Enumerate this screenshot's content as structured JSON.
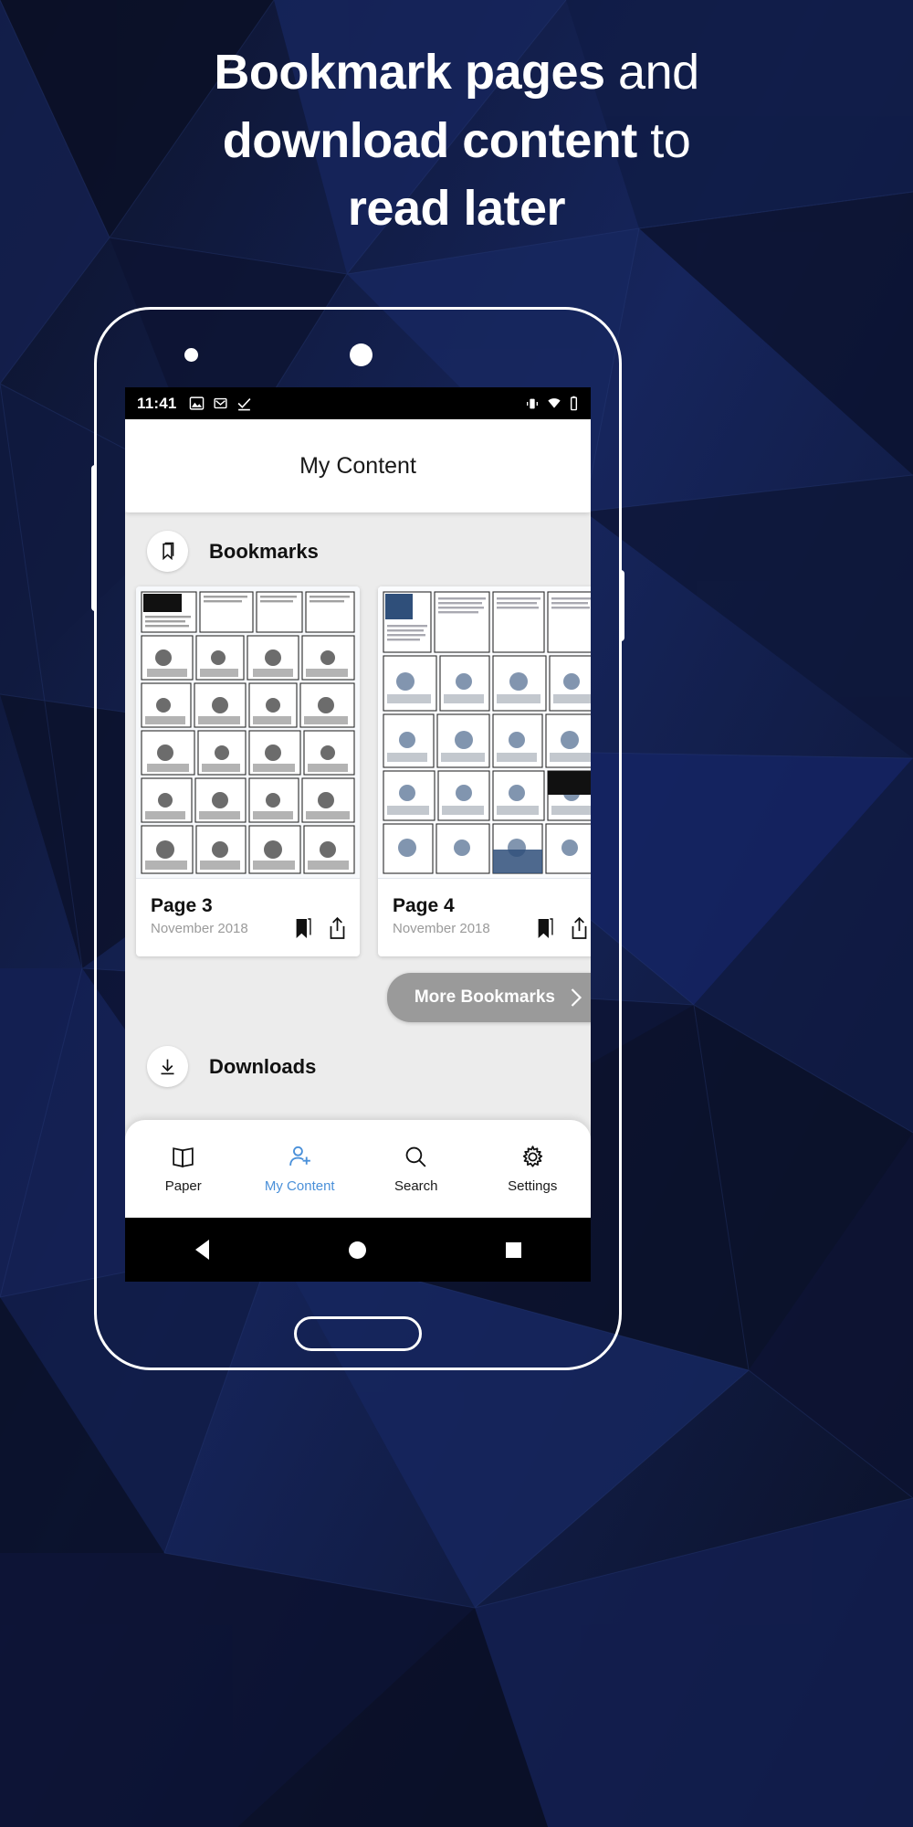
{
  "headline": {
    "line1_bold": "Bookmark pages",
    "line1_rest": " and",
    "line2_bold": "download content",
    "line2_rest": " to",
    "line3": "read later"
  },
  "colors": {
    "background_dark": "#0d1530",
    "background_mid": "#16255c",
    "accent_blue": "#4a90d9",
    "button_gray": "#9a9a9a",
    "app_body": "#ececec",
    "date_text": "#9a9a9a"
  },
  "statusbar": {
    "time": "11:41",
    "left_icons": [
      "photos-icon",
      "gmail-icon",
      "checkmark-icon"
    ],
    "right_icons": [
      "vibrate-icon",
      "wifi-icon",
      "battery-icon"
    ]
  },
  "header": {
    "title": "My Content"
  },
  "sections": [
    {
      "icon": "bookmark-icon",
      "label": "Bookmarks"
    },
    {
      "icon": "download-icon",
      "label": "Downloads"
    }
  ],
  "cards": [
    {
      "title": "Page 3",
      "date": "November 2018",
      "actions": [
        "bookmark-filled-icon",
        "share-icon"
      ]
    },
    {
      "title": "Page 4",
      "date": "November 2018",
      "actions": [
        "bookmark-filled-icon",
        "share-icon"
      ]
    }
  ],
  "more_button": {
    "label": "More Bookmarks",
    "chevron": "chevron-right-icon"
  },
  "bottom_nav": [
    {
      "icon": "paper-icon",
      "label": "Paper",
      "active": false
    },
    {
      "icon": "my-content-icon",
      "label": "My Content",
      "active": true
    },
    {
      "icon": "search-icon",
      "label": "Search",
      "active": false
    },
    {
      "icon": "settings-icon",
      "label": "Settings",
      "active": false
    }
  ],
  "android_nav": {
    "back": "back-triangle-icon",
    "home": "home-circle-icon",
    "recents": "recents-square-icon"
  }
}
